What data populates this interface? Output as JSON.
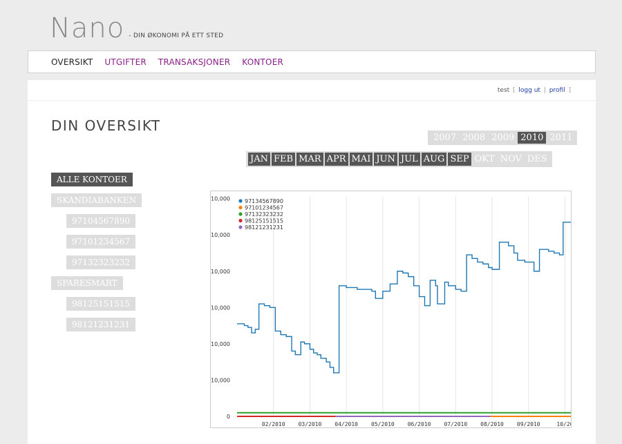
{
  "brand": {
    "logo": "Nano",
    "tagline": "- DIN ØKONOMI PÅ ETT STED"
  },
  "nav": {
    "items": [
      {
        "label": "OVERSIKT",
        "active": true
      },
      {
        "label": "UTGIFTER",
        "active": false
      },
      {
        "label": "TRANSAKSJONER",
        "active": false
      },
      {
        "label": "KONTOER",
        "active": false
      }
    ]
  },
  "user": {
    "name": "test",
    "logout_label": "logg ut",
    "profile_label": "profil"
  },
  "page": {
    "title": "DIN OVERSIKT"
  },
  "years": [
    {
      "label": "2007",
      "active": false
    },
    {
      "label": "2008",
      "active": false
    },
    {
      "label": "2009",
      "active": false
    },
    {
      "label": "2010",
      "active": true
    },
    {
      "label": "2011",
      "active": false
    }
  ],
  "months": [
    {
      "label": "JAN",
      "enabled": true
    },
    {
      "label": "FEB",
      "enabled": true
    },
    {
      "label": "MAR",
      "enabled": true
    },
    {
      "label": "APR",
      "enabled": true
    },
    {
      "label": "MAI",
      "enabled": true
    },
    {
      "label": "JUN",
      "enabled": true
    },
    {
      "label": "JUL",
      "enabled": true
    },
    {
      "label": "AUG",
      "enabled": true
    },
    {
      "label": "SEP",
      "enabled": true
    },
    {
      "label": "OKT",
      "enabled": false
    },
    {
      "label": "NOV",
      "enabled": false
    },
    {
      "label": "DES",
      "enabled": false
    }
  ],
  "accounts": [
    {
      "label": "ALLE KONTOER",
      "level": 0,
      "active": true
    },
    {
      "label": "SKANDIABANKEN",
      "level": 0,
      "active": false
    },
    {
      "label": "97104567890",
      "level": 1,
      "active": false
    },
    {
      "label": "97101234567",
      "level": 1,
      "active": false
    },
    {
      "label": "97132323232",
      "level": 1,
      "active": false
    },
    {
      "label": "SPARESMART",
      "level": 0,
      "active": false
    },
    {
      "label": "98125151515",
      "level": 1,
      "active": false
    },
    {
      "label": "98121231231",
      "level": 1,
      "active": false
    }
  ],
  "chart_data": {
    "type": "line",
    "legend_position": "top-left",
    "grid": "vertical",
    "y_ticks": [
      "10,000",
      "10,000",
      "10,000",
      "10,000",
      "10,000",
      "10,000",
      "0"
    ],
    "x_ticks": [
      "02/2010",
      "03/2010",
      "04/2010",
      "05/2010",
      "06/2010",
      "07/2010",
      "08/2010",
      "09/2010",
      "10/20"
    ],
    "xlim": [
      0,
      9.2
    ],
    "ylim": [
      0,
      6.05
    ],
    "series": [
      {
        "name": "97134567890",
        "color": "#1f77b4",
        "x": [
          0,
          0.2,
          0.3,
          0.4,
          0.5,
          0.6,
          0.75,
          0.9,
          1.05,
          1.2,
          1.35,
          1.5,
          1.6,
          1.75,
          1.85,
          2.0,
          2.1,
          2.2,
          2.3,
          2.45,
          2.55,
          2.65,
          2.8,
          3.0,
          3.3,
          3.7,
          3.8,
          4.0,
          4.2,
          4.4,
          4.55,
          4.7,
          4.85,
          5.0,
          5.15,
          5.3,
          5.45,
          5.5,
          5.7,
          5.8,
          6.0,
          6.15,
          6.3,
          6.45,
          6.6,
          6.75,
          6.9,
          7.0,
          7.2,
          7.45,
          7.6,
          7.7,
          7.9,
          8.15,
          8.3,
          8.55,
          8.7,
          8.85,
          8.95,
          9.2
        ],
        "y": [
          2.55,
          2.5,
          2.45,
          2.3,
          2.4,
          3.1,
          3.05,
          3.0,
          2.35,
          2.25,
          2.2,
          1.8,
          1.7,
          2.05,
          2.0,
          1.85,
          1.75,
          1.7,
          1.6,
          1.5,
          1.35,
          1.2,
          3.6,
          3.55,
          3.5,
          3.45,
          3.25,
          3.45,
          3.65,
          4.0,
          3.95,
          3.85,
          3.6,
          3.3,
          3.05,
          3.75,
          3.6,
          3.1,
          3.7,
          3.6,
          3.5,
          3.45,
          4.45,
          4.35,
          4.25,
          4.2,
          4.1,
          4.05,
          4.8,
          4.7,
          4.5,
          4.3,
          4.25,
          4.0,
          4.6,
          4.55,
          4.5,
          4.45,
          5.35,
          5.4
        ]
      },
      {
        "name": "97101234567",
        "color": "#ff7f0e",
        "x": [
          0,
          9.2
        ],
        "y": [
          0,
          0
        ]
      },
      {
        "name": "97132323232",
        "color": "#2ca02c",
        "x": [
          0,
          9.2
        ],
        "y": [
          0.1,
          0.1
        ]
      },
      {
        "name": "98125151515",
        "color": "#d62728",
        "x": [
          0,
          2.7
        ],
        "y": [
          0,
          0
        ]
      },
      {
        "name": "98121231231",
        "color": "#9467bd",
        "x": [
          2.7,
          6.95
        ],
        "y": [
          0,
          0
        ]
      }
    ]
  }
}
